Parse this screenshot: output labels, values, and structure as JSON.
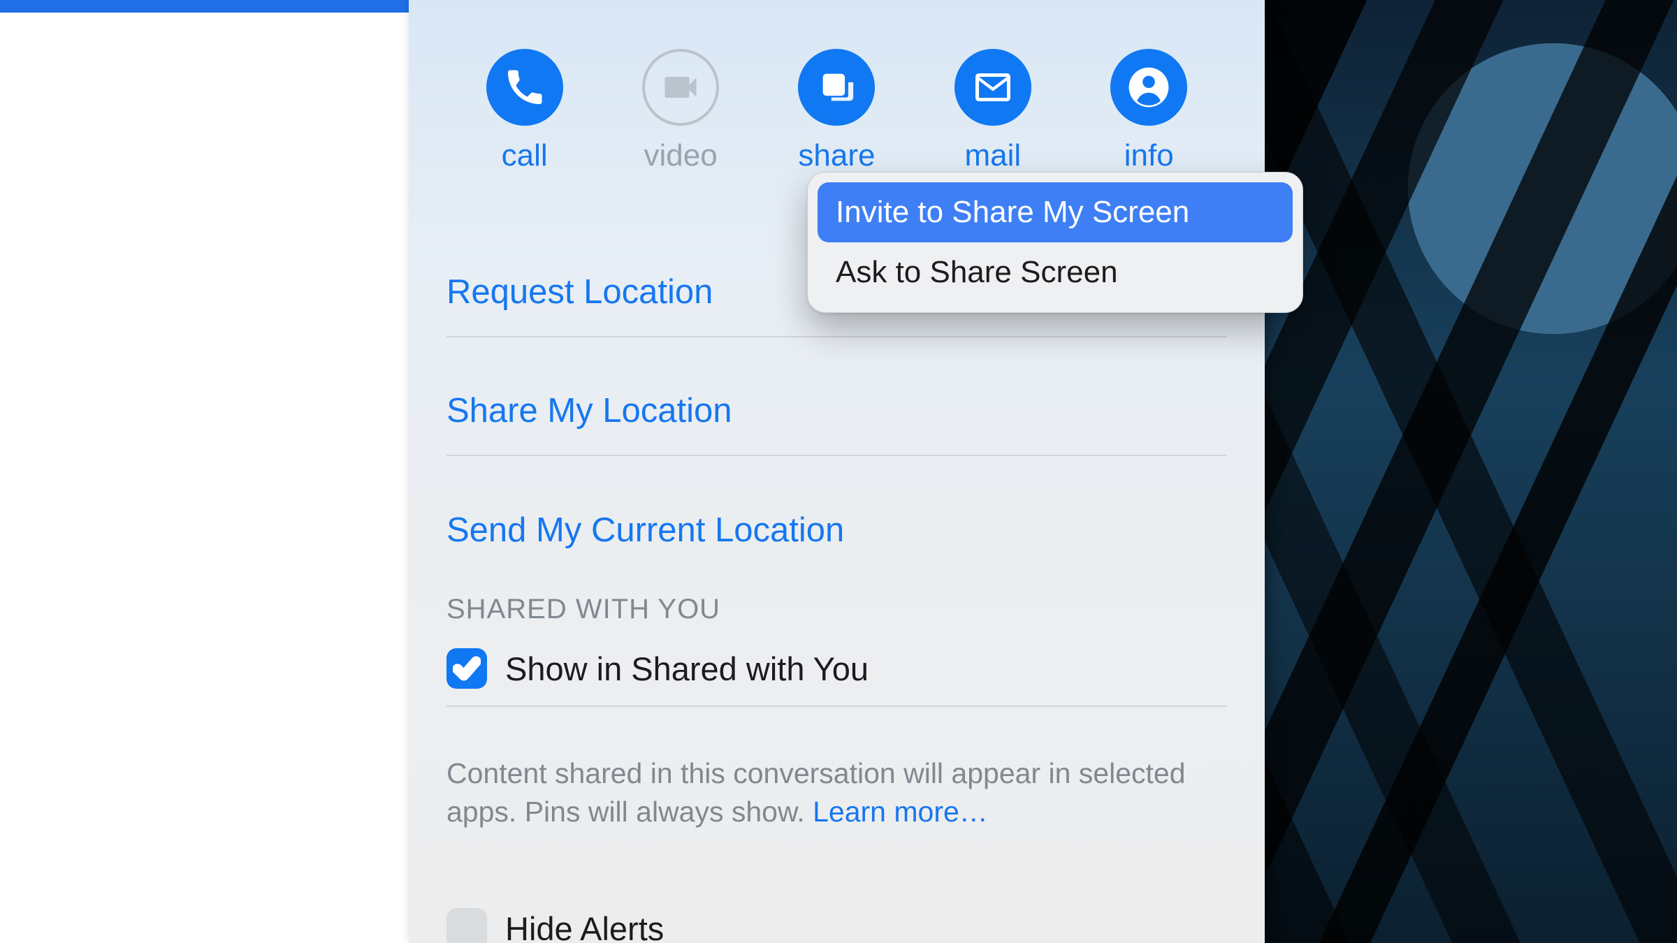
{
  "actions": {
    "call": "call",
    "video": "video",
    "share": "share",
    "mail": "mail",
    "info": "info"
  },
  "links": {
    "request_location": "Request Location",
    "share_my_location": "Share My Location",
    "send_current_location": "Send My Current Location"
  },
  "shared_with_you": {
    "header": "SHARED WITH YOU",
    "checkbox_label": "Show in Shared with You",
    "checked": true,
    "help_text": "Content shared in this conversation will appear in selected apps. Pins will always show. ",
    "learn_more": "Learn more…"
  },
  "hide_alerts": {
    "label": "Hide Alerts",
    "checked": false
  },
  "share_menu": {
    "invite": "Invite to Share My Screen",
    "ask": "Ask to Share Screen"
  }
}
